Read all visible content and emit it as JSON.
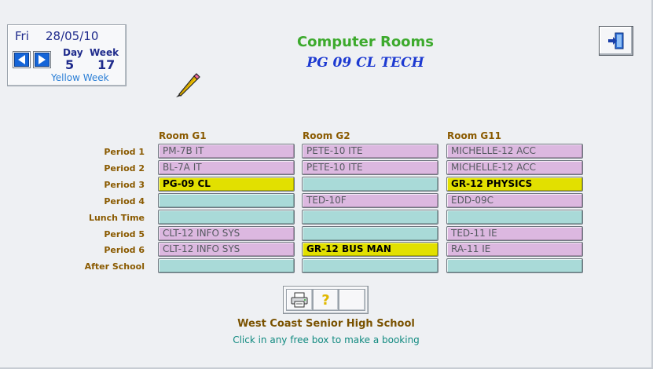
{
  "date_panel": {
    "day_name": "Fri",
    "date": "28/05/10",
    "day_label": "Day",
    "week_label": "Week",
    "day_value": "5",
    "week_value": "17",
    "week_type": "Yellow Week"
  },
  "header": {
    "title": "Computer Rooms",
    "subtitle": "PG 09 CL TECH"
  },
  "grid": {
    "rooms": [
      "Room G1",
      "Room G2",
      "Room G11"
    ],
    "periods": [
      "Period 1",
      "Period 2",
      "Period 3",
      "Period 4",
      "Lunch Time",
      "Period 5",
      "Period 6",
      "After School"
    ],
    "cells": [
      [
        "PM-7B IT",
        "PETE-10 ITE",
        "MICHELLE-12 ACC"
      ],
      [
        "BL-7A IT",
        "PETE-10 ITE",
        "MICHELLE-12 ACC"
      ],
      [
        "PG-09 CL",
        "",
        "GR-12 PHYSICS"
      ],
      [
        "",
        "TED-10F",
        "EDD-09C"
      ],
      [
        "",
        "",
        ""
      ],
      [
        "CLT-12 INFO SYS",
        "",
        "TED-11 IE"
      ],
      [
        "CLT-12 INFO SYS",
        "GR-12 BUS MAN",
        "RA-11 IE"
      ],
      [
        "",
        "",
        ""
      ]
    ],
    "highlighted": [
      "PG-09 CL",
      "GR-12 PHYSICS",
      "GR-12 BUS MAN"
    ]
  },
  "toolbar": {
    "print_icon": "printer-icon",
    "help_label": "?",
    "blank_label": ""
  },
  "footer": {
    "school": "West Coast Senior High School",
    "instruction": "Click in any free box to make a booking"
  },
  "colors": {
    "booked": "#dcb8e0",
    "free": "#a9dad8",
    "highlight": "#e2e000",
    "title": "#3daa2d",
    "subtitle": "#1d3ad1"
  }
}
